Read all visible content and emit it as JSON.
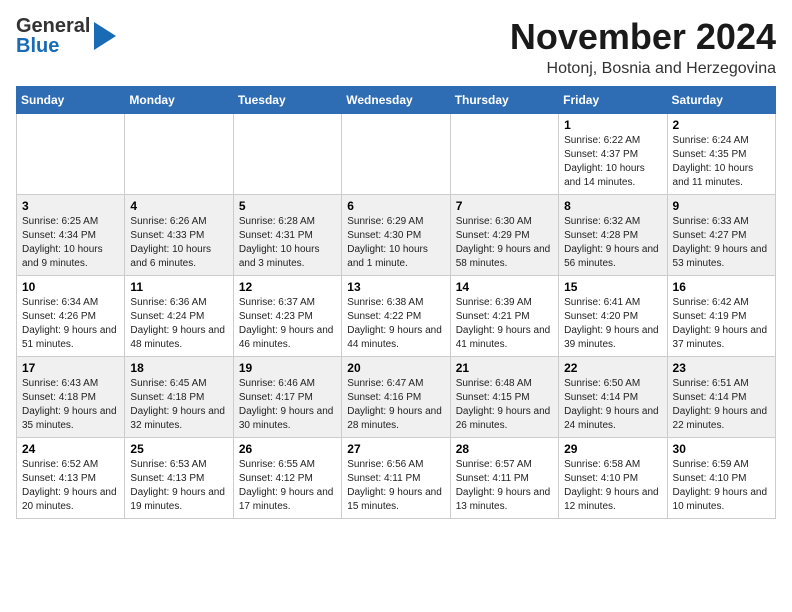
{
  "header": {
    "logo_general": "General",
    "logo_blue": "Blue",
    "month_title": "November 2024",
    "location": "Hotonj, Bosnia and Herzegovina"
  },
  "days_of_week": [
    "Sunday",
    "Monday",
    "Tuesday",
    "Wednesday",
    "Thursday",
    "Friday",
    "Saturday"
  ],
  "weeks": [
    {
      "days": [
        {
          "num": "",
          "info": ""
        },
        {
          "num": "",
          "info": ""
        },
        {
          "num": "",
          "info": ""
        },
        {
          "num": "",
          "info": ""
        },
        {
          "num": "",
          "info": ""
        },
        {
          "num": "1",
          "info": "Sunrise: 6:22 AM\nSunset: 4:37 PM\nDaylight: 10 hours and 14 minutes."
        },
        {
          "num": "2",
          "info": "Sunrise: 6:24 AM\nSunset: 4:35 PM\nDaylight: 10 hours and 11 minutes."
        }
      ]
    },
    {
      "days": [
        {
          "num": "3",
          "info": "Sunrise: 6:25 AM\nSunset: 4:34 PM\nDaylight: 10 hours and 9 minutes."
        },
        {
          "num": "4",
          "info": "Sunrise: 6:26 AM\nSunset: 4:33 PM\nDaylight: 10 hours and 6 minutes."
        },
        {
          "num": "5",
          "info": "Sunrise: 6:28 AM\nSunset: 4:31 PM\nDaylight: 10 hours and 3 minutes."
        },
        {
          "num": "6",
          "info": "Sunrise: 6:29 AM\nSunset: 4:30 PM\nDaylight: 10 hours and 1 minute."
        },
        {
          "num": "7",
          "info": "Sunrise: 6:30 AM\nSunset: 4:29 PM\nDaylight: 9 hours and 58 minutes."
        },
        {
          "num": "8",
          "info": "Sunrise: 6:32 AM\nSunset: 4:28 PM\nDaylight: 9 hours and 56 minutes."
        },
        {
          "num": "9",
          "info": "Sunrise: 6:33 AM\nSunset: 4:27 PM\nDaylight: 9 hours and 53 minutes."
        }
      ]
    },
    {
      "days": [
        {
          "num": "10",
          "info": "Sunrise: 6:34 AM\nSunset: 4:26 PM\nDaylight: 9 hours and 51 minutes."
        },
        {
          "num": "11",
          "info": "Sunrise: 6:36 AM\nSunset: 4:24 PM\nDaylight: 9 hours and 48 minutes."
        },
        {
          "num": "12",
          "info": "Sunrise: 6:37 AM\nSunset: 4:23 PM\nDaylight: 9 hours and 46 minutes."
        },
        {
          "num": "13",
          "info": "Sunrise: 6:38 AM\nSunset: 4:22 PM\nDaylight: 9 hours and 44 minutes."
        },
        {
          "num": "14",
          "info": "Sunrise: 6:39 AM\nSunset: 4:21 PM\nDaylight: 9 hours and 41 minutes."
        },
        {
          "num": "15",
          "info": "Sunrise: 6:41 AM\nSunset: 4:20 PM\nDaylight: 9 hours and 39 minutes."
        },
        {
          "num": "16",
          "info": "Sunrise: 6:42 AM\nSunset: 4:19 PM\nDaylight: 9 hours and 37 minutes."
        }
      ]
    },
    {
      "days": [
        {
          "num": "17",
          "info": "Sunrise: 6:43 AM\nSunset: 4:18 PM\nDaylight: 9 hours and 35 minutes."
        },
        {
          "num": "18",
          "info": "Sunrise: 6:45 AM\nSunset: 4:18 PM\nDaylight: 9 hours and 32 minutes."
        },
        {
          "num": "19",
          "info": "Sunrise: 6:46 AM\nSunset: 4:17 PM\nDaylight: 9 hours and 30 minutes."
        },
        {
          "num": "20",
          "info": "Sunrise: 6:47 AM\nSunset: 4:16 PM\nDaylight: 9 hours and 28 minutes."
        },
        {
          "num": "21",
          "info": "Sunrise: 6:48 AM\nSunset: 4:15 PM\nDaylight: 9 hours and 26 minutes."
        },
        {
          "num": "22",
          "info": "Sunrise: 6:50 AM\nSunset: 4:14 PM\nDaylight: 9 hours and 24 minutes."
        },
        {
          "num": "23",
          "info": "Sunrise: 6:51 AM\nSunset: 4:14 PM\nDaylight: 9 hours and 22 minutes."
        }
      ]
    },
    {
      "days": [
        {
          "num": "24",
          "info": "Sunrise: 6:52 AM\nSunset: 4:13 PM\nDaylight: 9 hours and 20 minutes."
        },
        {
          "num": "25",
          "info": "Sunrise: 6:53 AM\nSunset: 4:13 PM\nDaylight: 9 hours and 19 minutes."
        },
        {
          "num": "26",
          "info": "Sunrise: 6:55 AM\nSunset: 4:12 PM\nDaylight: 9 hours and 17 minutes."
        },
        {
          "num": "27",
          "info": "Sunrise: 6:56 AM\nSunset: 4:11 PM\nDaylight: 9 hours and 15 minutes."
        },
        {
          "num": "28",
          "info": "Sunrise: 6:57 AM\nSunset: 4:11 PM\nDaylight: 9 hours and 13 minutes."
        },
        {
          "num": "29",
          "info": "Sunrise: 6:58 AM\nSunset: 4:10 PM\nDaylight: 9 hours and 12 minutes."
        },
        {
          "num": "30",
          "info": "Sunrise: 6:59 AM\nSunset: 4:10 PM\nDaylight: 9 hours and 10 minutes."
        }
      ]
    }
  ]
}
